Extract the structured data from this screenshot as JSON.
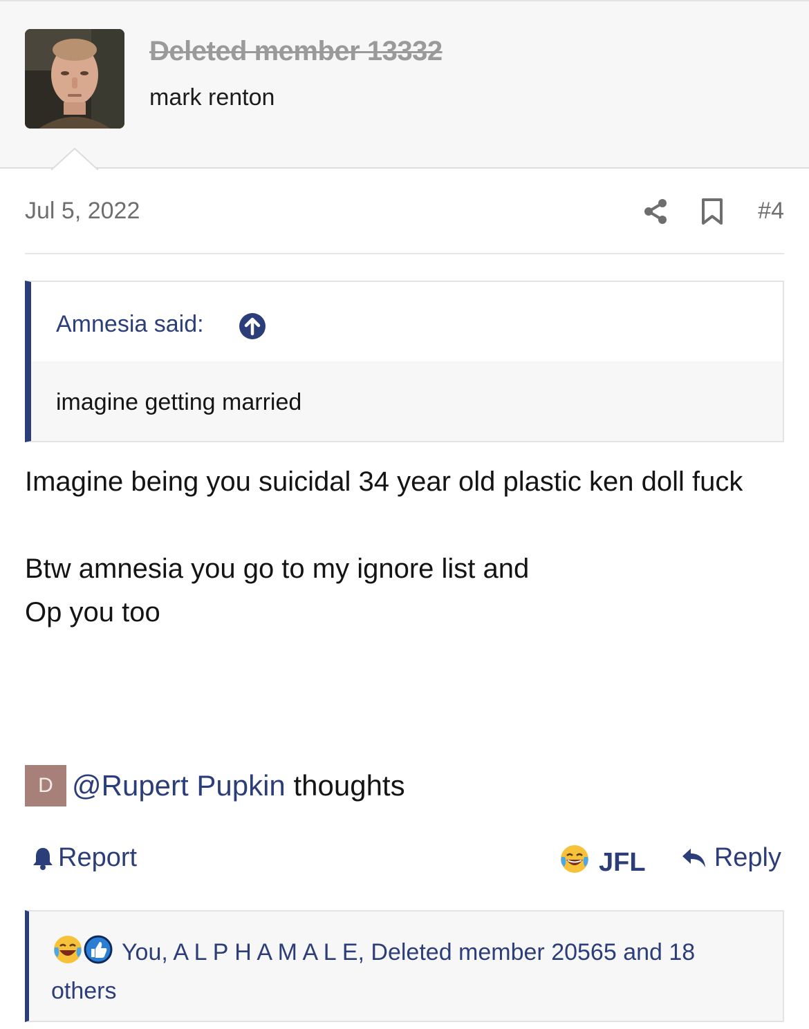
{
  "user": {
    "name": "Deleted member 13332",
    "title": "mark renton"
  },
  "post": {
    "date": "Jul 5, 2022",
    "number": "#4",
    "quote": {
      "author": "Amnesia said:",
      "text": "imagine getting married"
    },
    "message": {
      "line1": "Imagine being you suicidal 34 year old plastic ken doll fuck",
      "line2": "Btw amnesia you go to my ignore list and",
      "line3": "Op you too"
    },
    "mention": {
      "avatar_letter": "D",
      "link": "@Rupert Pupkin",
      "rest": " thoughts"
    }
  },
  "actions": {
    "report_label": "Report",
    "reaction_label": "JFL",
    "reply_label": "Reply"
  },
  "reactions": {
    "text": "You, A L P H A M A L E, Deleted member 20565 and 18 others"
  },
  "colors": {
    "link": "#2c3e7a",
    "header_bg": "#f7f7f7",
    "mini_avatar_bg": "#a8807a"
  }
}
